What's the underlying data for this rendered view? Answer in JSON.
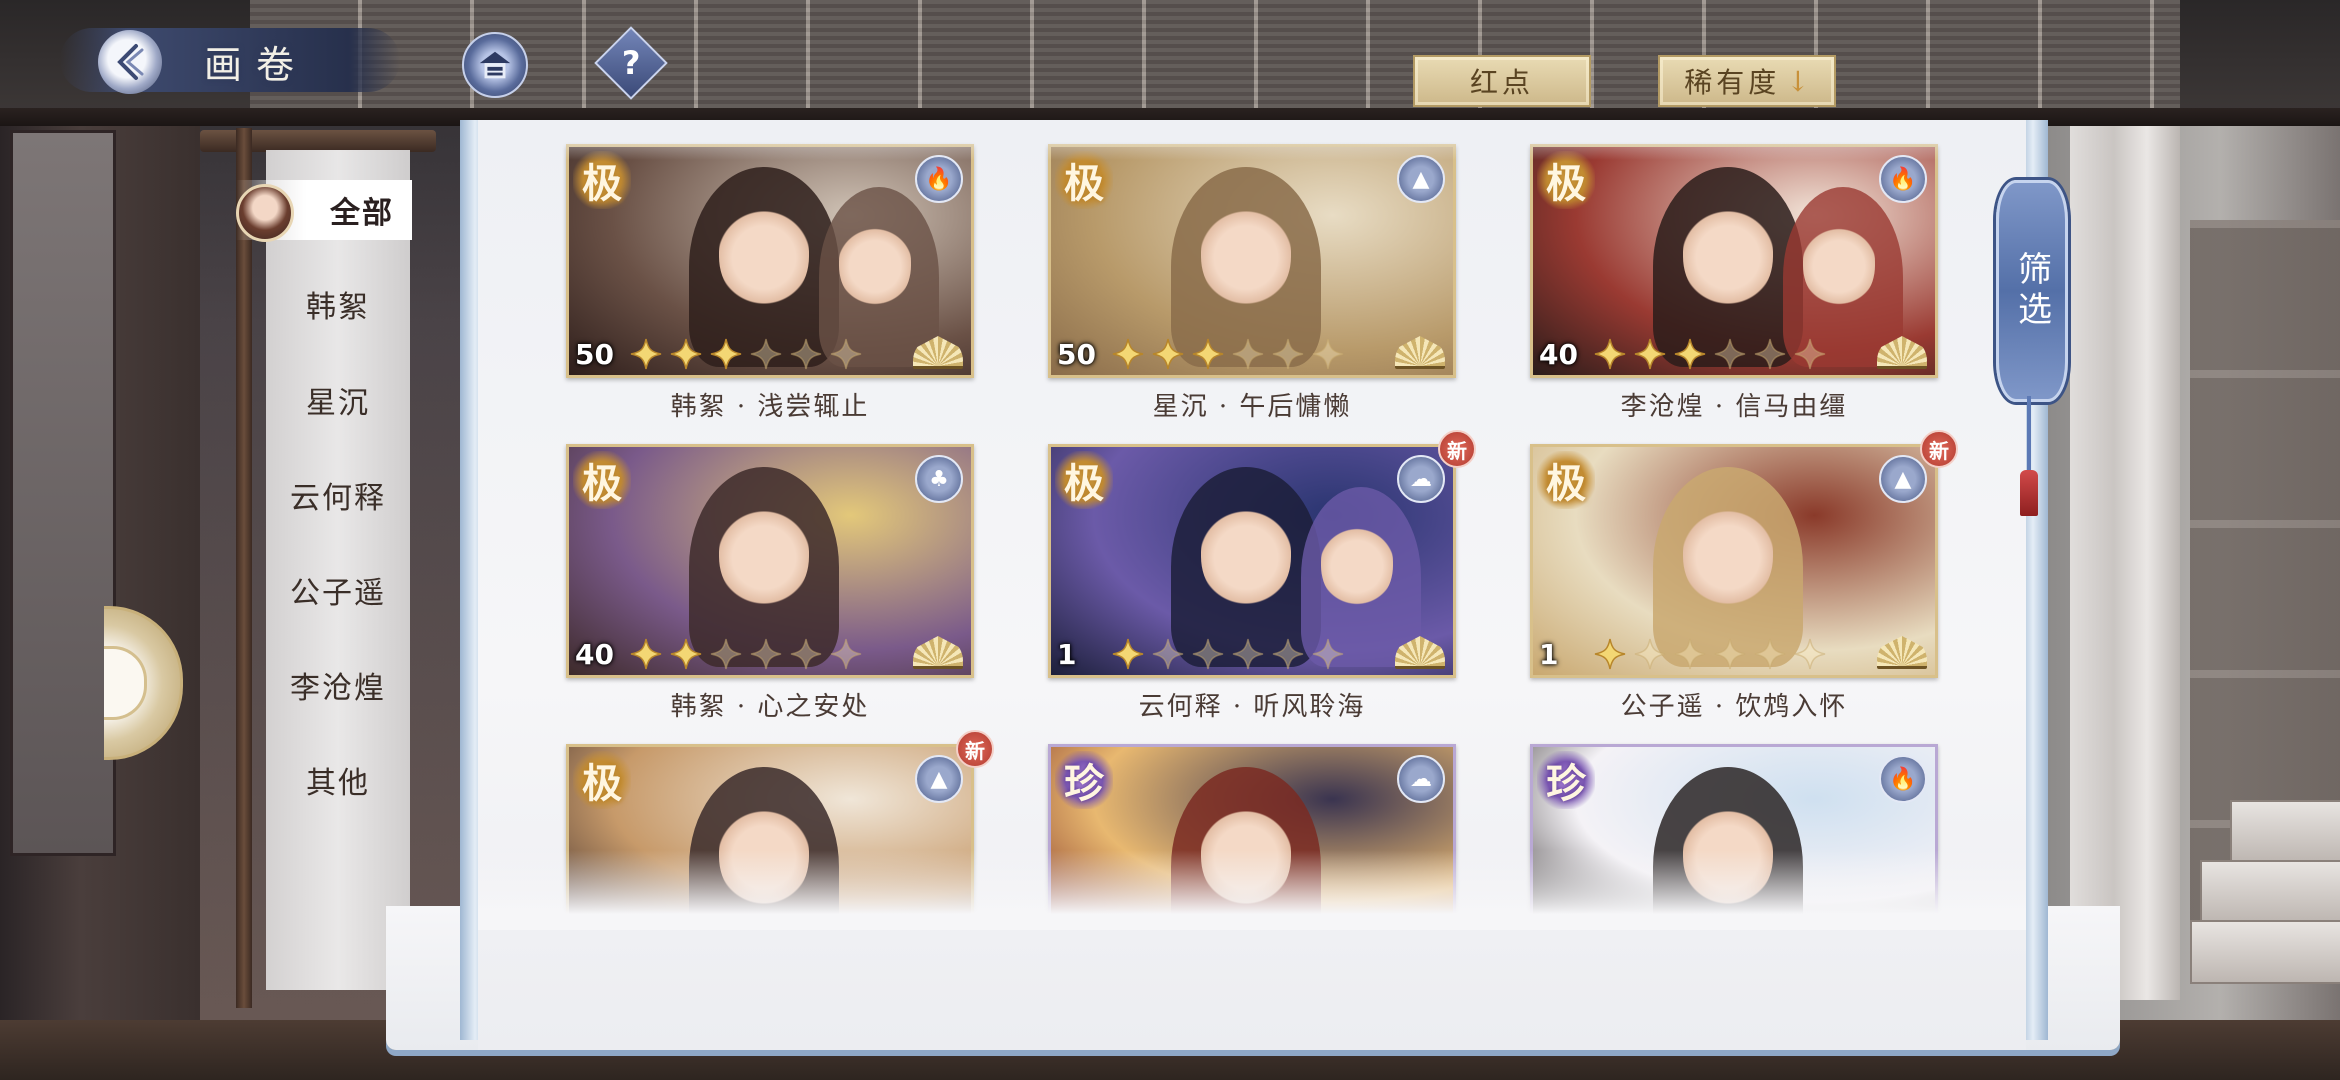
{
  "header": {
    "title": "画卷",
    "back_icon": "back-arrow-icon",
    "house_icon": "house-icon",
    "help_label": "?",
    "reddot_label": "红点",
    "rarity_label": "稀有度",
    "rarity_arrow": "↓"
  },
  "sidebar": {
    "items": [
      {
        "label": "全部",
        "active": true
      },
      {
        "label": "韩絮",
        "active": false
      },
      {
        "label": "星沉",
        "active": false
      },
      {
        "label": "云何释",
        "active": false
      },
      {
        "label": "公子遥",
        "active": false
      },
      {
        "label": "李沧煌",
        "active": false
      },
      {
        "label": "其他",
        "active": false
      }
    ]
  },
  "filter": {
    "label": "筛选"
  },
  "cards": [
    {
      "rank": "极",
      "level": "50",
      "stars": 3,
      "max_stars": 6,
      "attr_icon": "flame-icon",
      "new": false,
      "caption": "韩絮 · 浅尝辄止"
    },
    {
      "rank": "极",
      "level": "50",
      "stars": 3,
      "max_stars": 6,
      "attr_icon": "mountain-icon",
      "new": false,
      "caption": "星沉 · 午后慵懒"
    },
    {
      "rank": "极",
      "level": "40",
      "stars": 3,
      "max_stars": 6,
      "attr_icon": "flame-icon",
      "new": false,
      "caption": "李沧煌 · 信马由缰"
    },
    {
      "rank": "极",
      "level": "40",
      "stars": 2,
      "max_stars": 6,
      "attr_icon": "tree-icon",
      "new": false,
      "caption": "韩絮 · 心之安处"
    },
    {
      "rank": "极",
      "level": "1",
      "stars": 1,
      "max_stars": 6,
      "attr_icon": "wind-icon",
      "new": true,
      "new_label": "新",
      "caption": "云何释 · 听风聆海"
    },
    {
      "rank": "极",
      "level": "1",
      "stars": 1,
      "max_stars": 6,
      "attr_icon": "mountain-icon",
      "new": true,
      "new_label": "新",
      "caption": "公子遥 · 饮鸩入怀"
    },
    {
      "rank": "极",
      "level": "",
      "stars": 0,
      "max_stars": 0,
      "attr_icon": "mountain-icon",
      "new": true,
      "new_label": "新",
      "caption": ""
    },
    {
      "rank": "珍",
      "level": "",
      "stars": 0,
      "max_stars": 0,
      "attr_icon": "wind-icon",
      "new": false,
      "caption": ""
    },
    {
      "rank": "珍",
      "level": "",
      "stars": 0,
      "max_stars": 0,
      "attr_icon": "flame-icon",
      "new": false,
      "caption": ""
    }
  ],
  "colors": {
    "gold": "#d8c08a",
    "purple": "#b9a8d4",
    "filter_blue": "#5470a8",
    "new_red": "#c0463a"
  }
}
